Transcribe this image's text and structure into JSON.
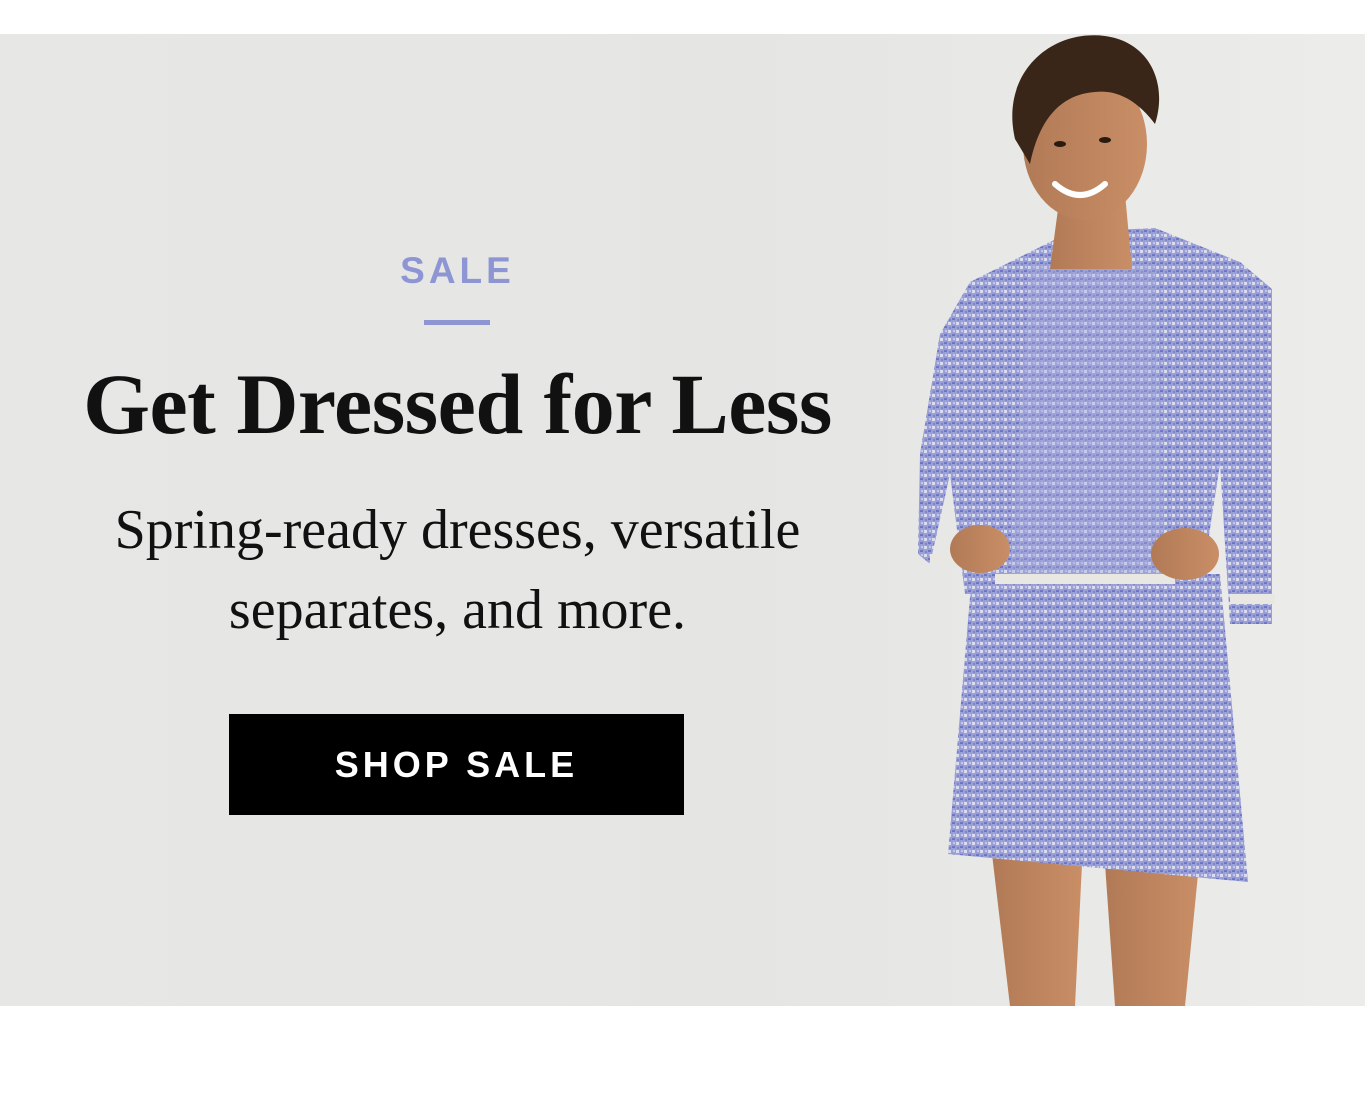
{
  "promo": {
    "eyebrow": "SALE",
    "headline": "Get Dressed for Less",
    "subhead_line1": "Spring-ready dresses, versatile",
    "subhead_line2": "separates, and more.",
    "cta_label": "SHOP SALE"
  },
  "colors": {
    "accent": "#8e95d3",
    "background": "#e6e6e4",
    "cta_bg": "#000000",
    "cta_text": "#ffffff",
    "tweed": "#8f96d2"
  },
  "image": {
    "subject": "model-in-blue-tweed-suit"
  }
}
